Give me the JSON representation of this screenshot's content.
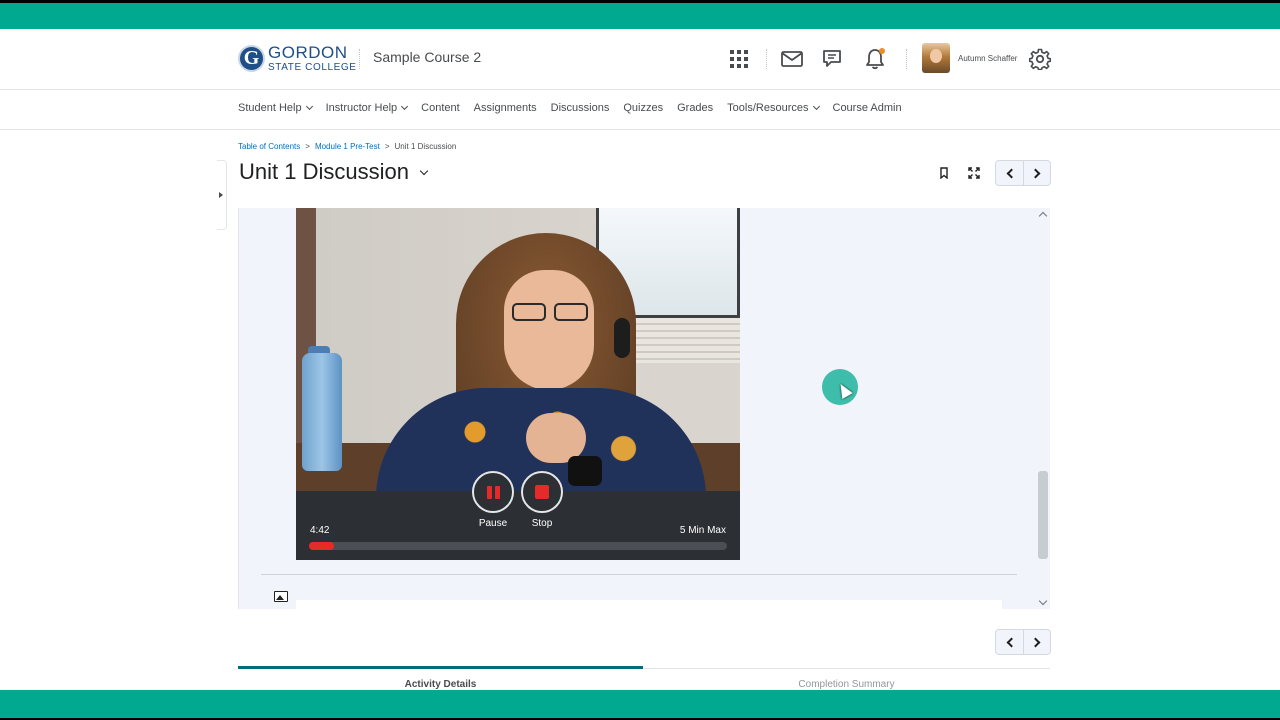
{
  "header": {
    "logo_main": "GORDON",
    "logo_sub": "STATE COLLEGE",
    "logo_letter": "G",
    "course_title": "Sample Course 2",
    "user_name": "Autumn Schaffer",
    "icons": [
      "waffle-icon",
      "mail-icon",
      "chat-icon",
      "bell-icon",
      "gear-icon"
    ]
  },
  "nav": {
    "items": [
      {
        "label": "Student Help",
        "dropdown": true
      },
      {
        "label": "Instructor Help",
        "dropdown": true
      },
      {
        "label": "Content",
        "dropdown": false
      },
      {
        "label": "Assignments",
        "dropdown": false
      },
      {
        "label": "Discussions",
        "dropdown": false
      },
      {
        "label": "Quizzes",
        "dropdown": false
      },
      {
        "label": "Grades",
        "dropdown": false
      },
      {
        "label": "Tools/Resources",
        "dropdown": true
      },
      {
        "label": "Course Admin",
        "dropdown": false
      }
    ]
  },
  "breadcrumbs": {
    "items": [
      "Table of Contents",
      "Module 1 Pre-Test"
    ],
    "current": "Unit 1 Discussion",
    "separator": ">"
  },
  "page": {
    "title": "Unit 1 Discussion"
  },
  "recorder": {
    "pause_label": "Pause",
    "stop_label": "Stop",
    "elapsed": "4:42",
    "max_label": "5 Min Max",
    "progress_fraction": 0.06
  },
  "tabs": {
    "active": "Activity Details",
    "inactive": "Completion Summary"
  },
  "colors": {
    "brand_teal": "#00a98f",
    "record_red": "#e52a2a",
    "link_blue": "#006fbf",
    "tab_accent": "#006d7a",
    "logo_blue": "#1f4f86"
  }
}
